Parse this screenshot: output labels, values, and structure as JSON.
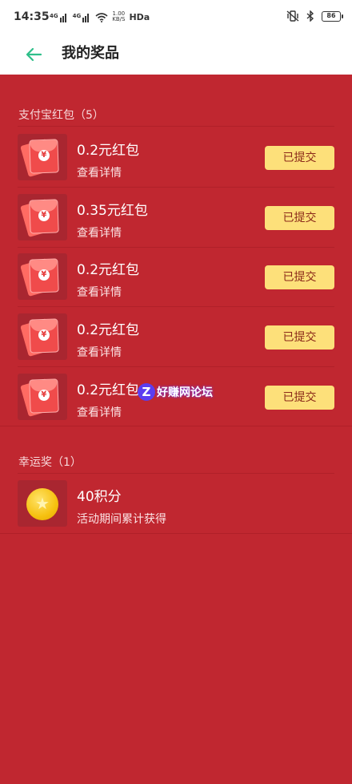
{
  "status_bar": {
    "time": "14:35",
    "signal_tag": "4G",
    "speed": "1.00\nKB/S",
    "hd": "HDa",
    "battery": "86"
  },
  "header": {
    "title": "我的奖品"
  },
  "alipay_section": {
    "title": "支付宝红包（5）",
    "items": [
      {
        "name": "0.2元红包",
        "sub": "查看详情",
        "button": "已提交"
      },
      {
        "name": "0.35元红包",
        "sub": "查看详情",
        "button": "已提交"
      },
      {
        "name": "0.2元红包",
        "sub": "查看详情",
        "button": "已提交"
      },
      {
        "name": "0.2元红包",
        "sub": "查看详情",
        "button": "已提交"
      },
      {
        "name": "0.2元红包",
        "sub": "查看详情",
        "button": "已提交"
      }
    ]
  },
  "lucky_section": {
    "title": "幸运奖（1）",
    "items": [
      {
        "name": "40积分",
        "sub": "活动期间累计获得"
      }
    ]
  },
  "watermark": {
    "letter": "Z",
    "text": "好赚网论坛"
  },
  "colors": {
    "background": "#c02730",
    "button": "#fde07a",
    "accent": "#2fbf8a"
  }
}
